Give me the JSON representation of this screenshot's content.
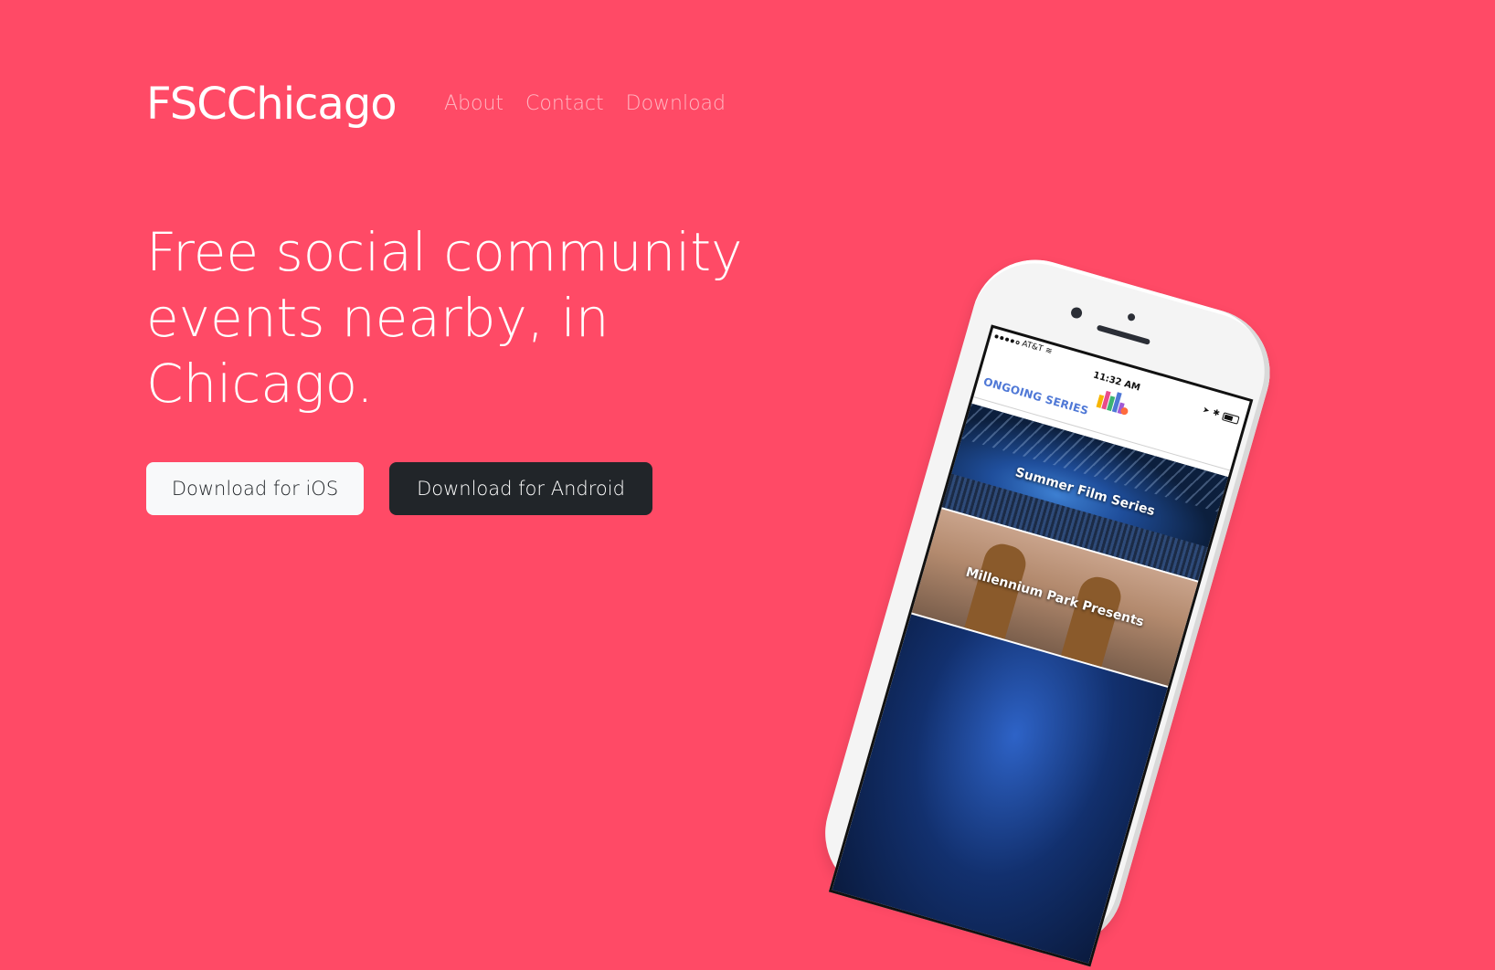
{
  "nav": {
    "brand": "FSCChicago",
    "links": [
      {
        "label": "About"
      },
      {
        "label": "Contact"
      },
      {
        "label": "Download"
      }
    ]
  },
  "hero": {
    "title": "Free social community events nearby, in Chicago.",
    "buttons": {
      "ios": "Download for iOS",
      "android": "Download for Android"
    }
  },
  "phone": {
    "carrier": "AT&T",
    "time": "11:32 AM",
    "section_label": "ONGOING SERIES",
    "cards": [
      {
        "label": "Summer Film Series"
      },
      {
        "label": "Millennium Park Presents"
      },
      {
        "label": ""
      }
    ]
  },
  "colors": {
    "background": "#ff4a66",
    "ios_button": "#f8f9fa",
    "android_button": "#212529",
    "section_label": "#4f78d6"
  }
}
